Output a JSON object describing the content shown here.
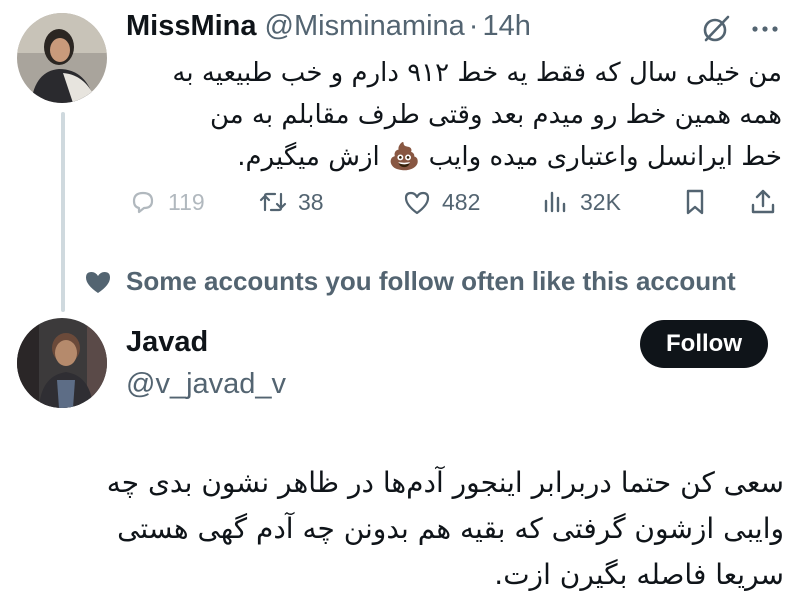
{
  "tweet1": {
    "author_name": "MissMina",
    "handle": "@Misminamina",
    "separator": "·",
    "time": "14h",
    "text": "من خیلی سال که فقط یه خط ۹۱۲ دارم و خب طبیعیه به\nهمه همین خط رو میدم بعد وقتی طرف مقابلم به من\nخط ایرانسل واعتباری میده وایب 💩 ازش میگیرم.",
    "stats": {
      "replies": "119",
      "retweets": "38",
      "likes": "482",
      "views": "32K"
    },
    "icons": {
      "header": [
        "grok-icon",
        "more-icon"
      ],
      "actions": [
        "reply-icon",
        "retweet-icon",
        "like-icon",
        "views-icon",
        "bookmark-icon",
        "share-icon"
      ]
    }
  },
  "social_context": {
    "text": "Some accounts you follow often like this account",
    "icon": "heart-icon"
  },
  "tweet2": {
    "author_name": "Javad",
    "handle": "@v_javad_v",
    "follow_label": "Follow",
    "text": "سعی کن حتما دربرابر اینجور آدم‌ها در ظاهر نشون بدی چه\nوایبی ازشون گرفتی که بقیه هم بدونن چه آدم گهی هستی\nسریعا فاصله بگیرن ازت."
  },
  "colors": {
    "text_primary": "#0f1419",
    "text_secondary": "#536471",
    "thread_line": "#cfd9de",
    "follow_button": "#0f1419"
  }
}
